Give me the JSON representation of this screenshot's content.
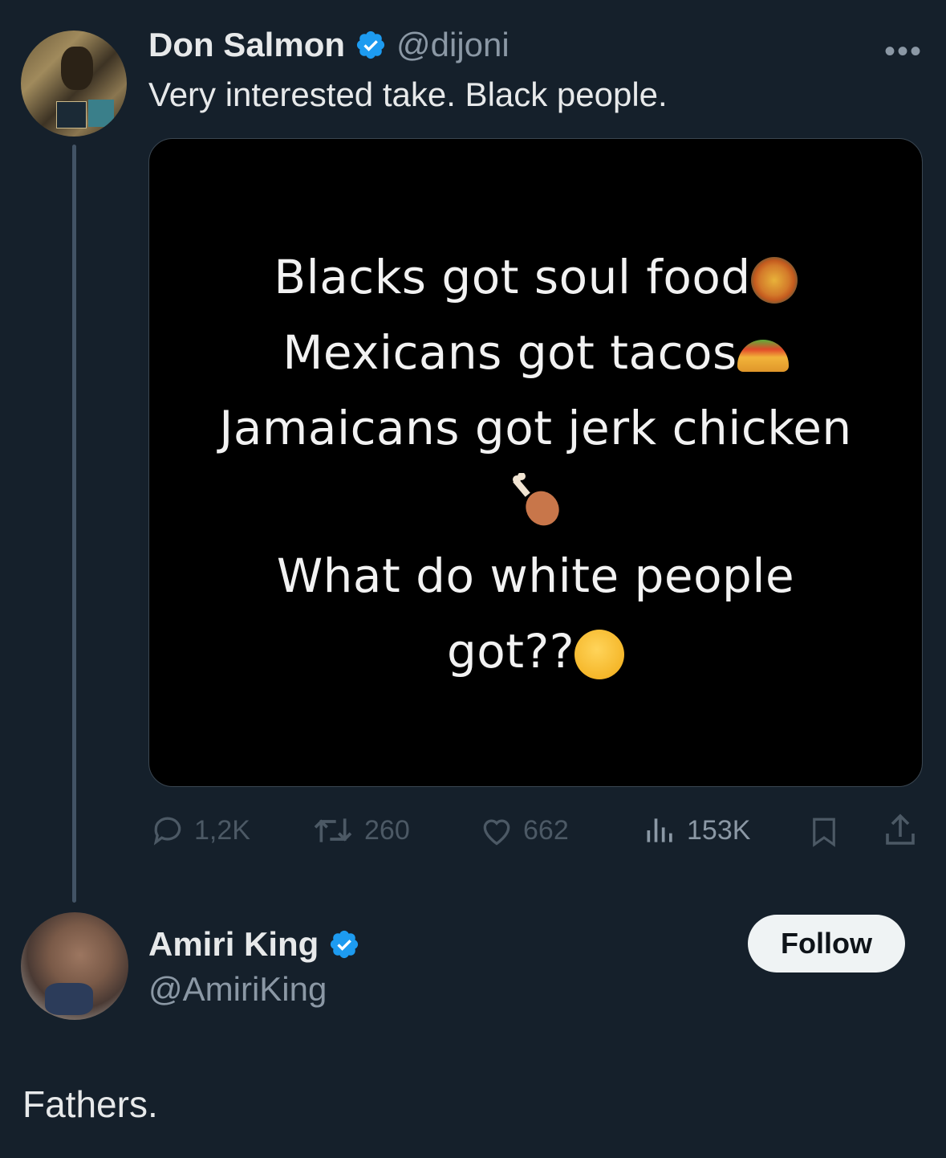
{
  "tweet": {
    "author_name": "Don Salmon",
    "author_handle": "@dijoni",
    "text": "Very interested take. Black people.",
    "more_label": "•••",
    "image_text": {
      "line1": "Blacks got soul food",
      "line2": "Mexicans got tacos",
      "line3": "Jamaicans got jerk chicken",
      "line4": "What do white people",
      "line5": "got??"
    },
    "stats": {
      "replies": "1,2K",
      "retweets": "260",
      "likes": "662",
      "views": "153K"
    }
  },
  "reply": {
    "author_name": "Amiri King",
    "author_handle": "@AmiriKing",
    "follow_label": "Follow",
    "text": "Fathers."
  },
  "colors": {
    "background": "#15202b",
    "verified": "#1d9bf0",
    "muted": "#8b98a5"
  },
  "icons": [
    "verified-badge-icon",
    "more-icon",
    "reply-icon",
    "retweet-icon",
    "like-icon",
    "views-icon",
    "bookmark-icon",
    "share-icon"
  ]
}
